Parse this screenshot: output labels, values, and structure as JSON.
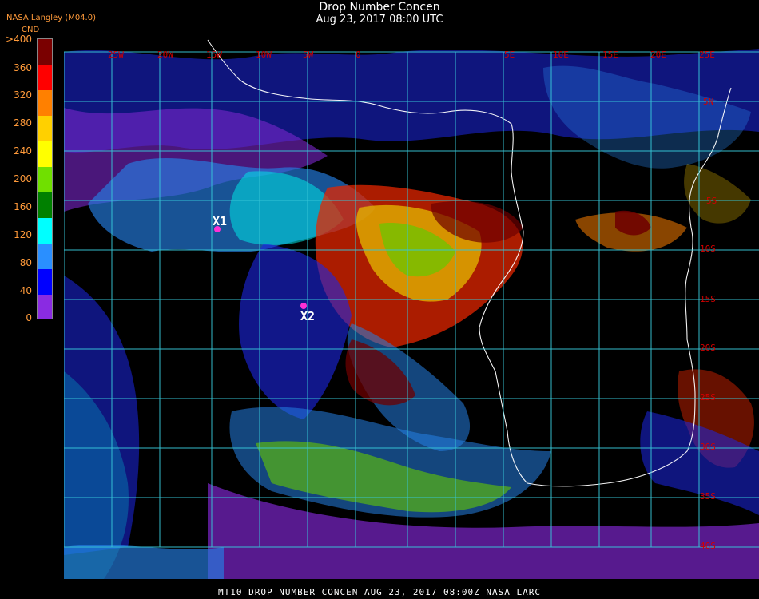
{
  "header": {
    "title": "Drop Number Concen",
    "timestamp": "Aug 23, 2017 08:00 UTC",
    "org": "NASA Langley (M04.0)"
  },
  "legend": {
    "unit": "CND",
    "labels": [
      ">400",
      "360",
      "320",
      "280",
      "240",
      "200",
      "160",
      "120",
      "80",
      "40",
      "0"
    ],
    "colors": [
      "#7a0000",
      "#ff0000",
      "#ff8000",
      "#ffd000",
      "#ffff00",
      "#70e000",
      "#008000",
      "#00ffff",
      "#2a8fff",
      "#0000ff",
      "#8a2be2"
    ]
  },
  "map": {
    "lat_labels": [
      "5N",
      "5S",
      "10S",
      "15S",
      "20S",
      "25S",
      "30S",
      "35S",
      "40S"
    ],
    "lon_labels": [
      "25W",
      "20W",
      "15W",
      "10W",
      "5W",
      "0",
      "5E",
      "10E",
      "15E",
      "20E",
      "25E"
    ],
    "markers": [
      "X1",
      "X2"
    ]
  },
  "footer": "MT10  DROP NUMBER CONCEN   AUG 23, 2017 08:00Z   NASA LARC"
}
